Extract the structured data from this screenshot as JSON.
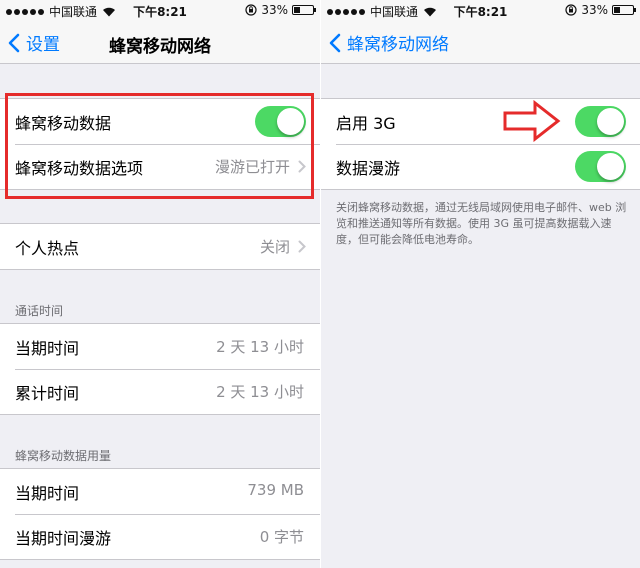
{
  "status_bar": {
    "carrier": "中国联通",
    "time": "下午8:21",
    "battery": "33%",
    "battery_level": 0.33
  },
  "left_screen": {
    "back_label": "设置",
    "title": "蜂窝移动网络",
    "group1": {
      "cellular_data": {
        "label": "蜂窝移动数据",
        "on": true
      },
      "cellular_options": {
        "label": "蜂窝移动数据选项",
        "value": "漫游已打开"
      }
    },
    "hotspot": {
      "label": "个人热点",
      "value": "关闭"
    },
    "call_time": {
      "header": "通话时间",
      "current": {
        "label": "当期时间",
        "value": "2 天 13 小时"
      },
      "lifetime": {
        "label": "累计时间",
        "value": "2 天 13 小时"
      }
    },
    "data_usage": {
      "header": "蜂窝移动数据用量",
      "current": {
        "label": "当期时间",
        "value": "739 MB"
      },
      "roaming": {
        "label": "当期时间漫游",
        "value": "0 字节"
      }
    }
  },
  "right_screen": {
    "back_label": "蜂窝移动网络",
    "enable_3g": {
      "label": "启用 3G",
      "on": true
    },
    "data_roaming": {
      "label": "数据漫游",
      "on": true
    },
    "footer": "关闭蜂窝移动数据，通过无线局域网使用电子邮件、web 浏览和推送通知等所有数据。使用 3G 虽可提高数据载入速度，但可能会降低电池寿命。"
  },
  "colors": {
    "accent": "#007aff",
    "switch_on": "#4cd964",
    "annotation": "#e52b2b"
  }
}
